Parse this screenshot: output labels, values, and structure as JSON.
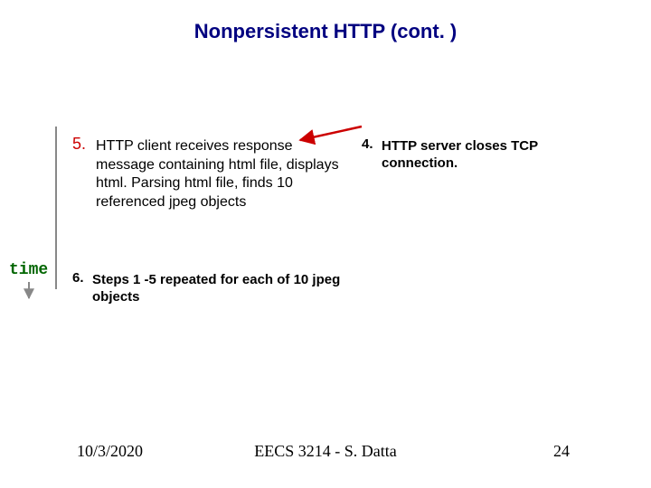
{
  "title": "Nonpersistent HTTP (cont. )",
  "time_label": "time",
  "step5": {
    "num": "5.",
    "text": "HTTP client receives response message containing html file, displays html.  Parsing html file, finds 10 referenced jpeg objects"
  },
  "step4": {
    "num": "4.",
    "text": "HTTP server closes TCP connection."
  },
  "step6": {
    "num": "6.",
    "text": "Steps 1 -5 repeated for each of 10 jpeg objects"
  },
  "footer": {
    "date": "10/3/2020",
    "center": "EECS 3214 - S. Datta",
    "page": "24"
  }
}
